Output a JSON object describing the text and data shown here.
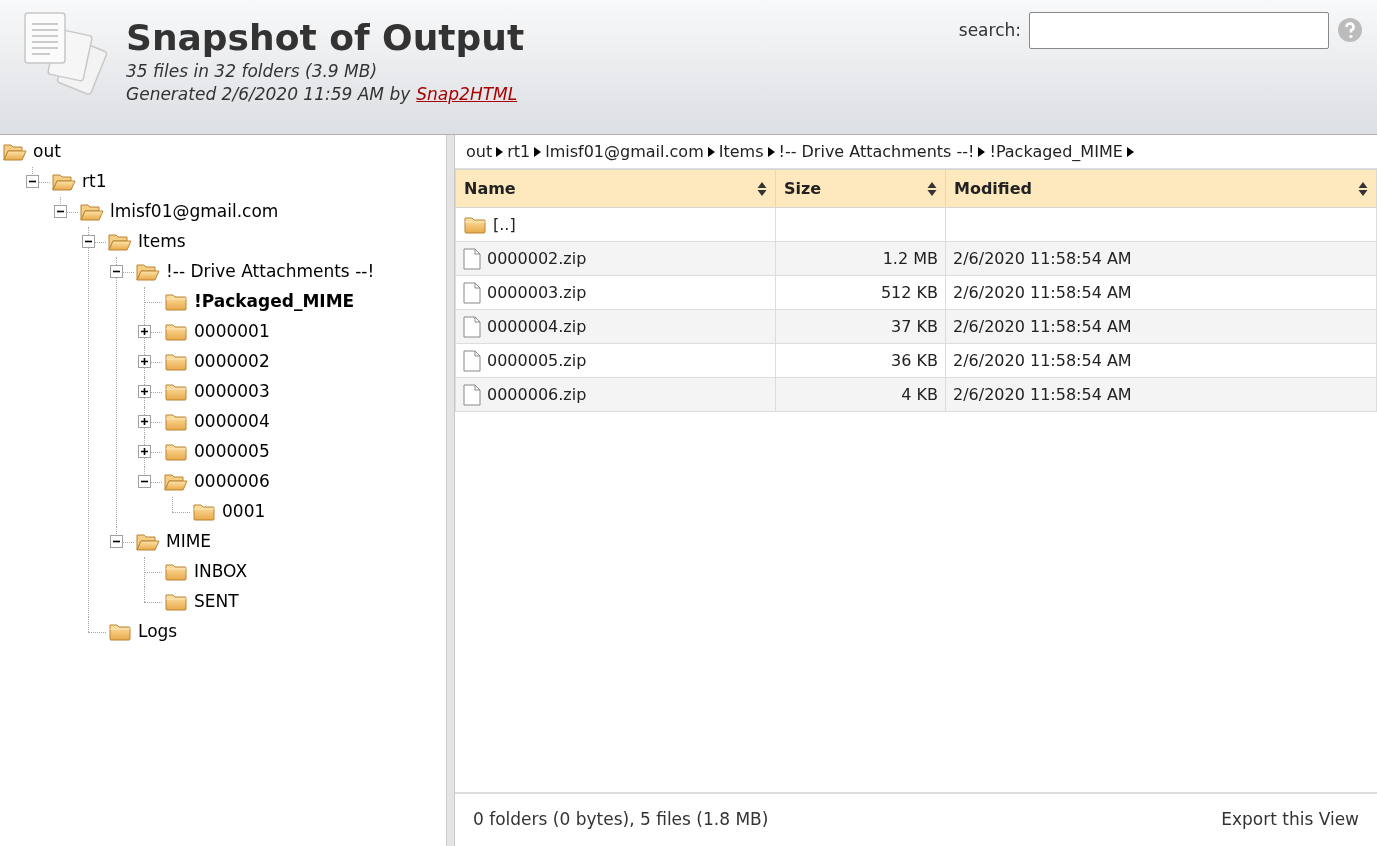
{
  "header": {
    "title": "Snapshot of Output",
    "summary": "35 files in 32 folders (3.9 MB)",
    "generated": "Generated 2/6/2020 11:59 AM by",
    "generator_link": "Snap2HTML"
  },
  "search": {
    "label": "search:"
  },
  "tree": {
    "label": "out",
    "expanded": true,
    "selected": false,
    "children": [
      {
        "label": "rt1",
        "expanded": true,
        "selected": false,
        "children": [
          {
            "label": "lmisf01@gmail.com",
            "expanded": true,
            "selected": false,
            "children": [
              {
                "label": "Items",
                "expanded": true,
                "selected": false,
                "children": [
                  {
                    "label": "!-- Drive Attachments --!",
                    "expanded": true,
                    "selected": false,
                    "children": [
                      {
                        "label": "!Packaged_MIME",
                        "selected": true
                      },
                      {
                        "label": "0000001",
                        "expanded": false,
                        "selected": false
                      },
                      {
                        "label": "0000002",
                        "expanded": false,
                        "selected": false
                      },
                      {
                        "label": "0000003",
                        "expanded": false,
                        "selected": false
                      },
                      {
                        "label": "0000004",
                        "expanded": false,
                        "selected": false
                      },
                      {
                        "label": "0000005",
                        "expanded": false,
                        "selected": false
                      },
                      {
                        "label": "0000006",
                        "expanded": true,
                        "selected": false,
                        "children": [
                          {
                            "label": "0001",
                            "selected": false
                          }
                        ]
                      }
                    ]
                  },
                  {
                    "label": "MIME",
                    "expanded": true,
                    "selected": false,
                    "children": [
                      {
                        "label": "INBOX",
                        "selected": false
                      },
                      {
                        "label": "SENT",
                        "selected": false
                      }
                    ]
                  }
                ]
              },
              {
                "label": "Logs",
                "selected": false
              }
            ]
          }
        ]
      }
    ]
  },
  "breadcrumb": [
    "out",
    "rt1",
    "lmisf01@gmail.com",
    "Items",
    "!-- Drive Attachments --!",
    "!Packaged_MIME"
  ],
  "table": {
    "columns": [
      "Name",
      "Size",
      "Modified"
    ],
    "rows": [
      {
        "kind": "parent",
        "name": "[..]"
      },
      {
        "kind": "file",
        "name": "0000002.zip",
        "size": "1.2 MB",
        "modified": "2/6/2020 11:58:54 AM"
      },
      {
        "kind": "file",
        "name": "0000003.zip",
        "size": "512 KB",
        "modified": "2/6/2020 11:58:54 AM"
      },
      {
        "kind": "file",
        "name": "0000004.zip",
        "size": "37 KB",
        "modified": "2/6/2020 11:58:54 AM"
      },
      {
        "kind": "file",
        "name": "0000005.zip",
        "size": "36 KB",
        "modified": "2/6/2020 11:58:54 AM"
      },
      {
        "kind": "file",
        "name": "0000006.zip",
        "size": "4 KB",
        "modified": "2/6/2020 11:58:54 AM"
      }
    ]
  },
  "status_bar": {
    "summary": "0 folders (0 bytes), 5 files (1.8 MB)",
    "export_link": "Export this View"
  }
}
